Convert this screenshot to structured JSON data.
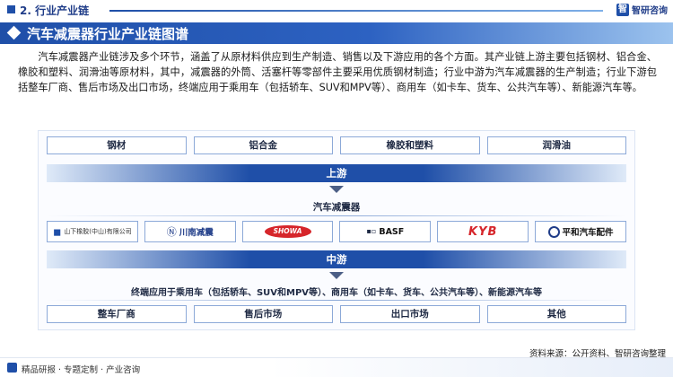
{
  "header": {
    "section_title": "2. 行业产业链",
    "brand_name": "智研咨询",
    "brand_icon": "zhiyan-logo-icon"
  },
  "banner": {
    "title": "汽车减震器行业产业链图谱"
  },
  "intro": "汽车减震器产业链涉及多个环节，涵盖了从原材料供应到生产制造、销售以及下游应用的各个方面。其产业链上游主要包括钢材、铝合金、橡胶和塑料、润滑油等原材料，其中，减震器的外筒、活塞杆等零部件主要采用优质钢材制造；行业中游为汽车减震器的生产制造；行业下游包括整车厂商、售后市场及出口市场，终端应用于乘用车（包括轿车、SUV和MPV等）、商用车（如卡车、货车、公共汽车等）、新能源汽车等。",
  "diagram": {
    "upstream_items": [
      "钢材",
      "铝合金",
      "橡胶和塑料",
      "润滑油"
    ],
    "upstream_label": "上游",
    "midstream_title": "汽车减震器",
    "companies": [
      {
        "name": "山下橡胶(中山)有限公司",
        "icon": "yamashita-logo-icon"
      },
      {
        "name": "川南减震",
        "icon": "chuannan-logo-icon"
      },
      {
        "name": "SHOWA",
        "icon": "showa-logo-icon"
      },
      {
        "name": "BASF",
        "icon": "basf-logo-icon"
      },
      {
        "name": "KYB",
        "icon": "kyb-logo-icon"
      },
      {
        "name": "平和汽车配件",
        "icon": "pinghe-logo-icon"
      }
    ],
    "midstream_label": "中游",
    "downstream_title": "终端应用于乘用车（包括轿车、SUV和MPV等）、商用车（如卡车、货车、公共汽车等）、新能源汽车等",
    "downstream_items": [
      "整车厂商",
      "售后市场",
      "出口市场",
      "其他"
    ]
  },
  "footer": {
    "left_text": "精品研报 · 专题定制 · 产业咨询",
    "source": "资料来源：公开资料、智研咨询整理"
  },
  "colors": {
    "primary": "#1f4fa8",
    "accent_red": "#d6262b"
  }
}
